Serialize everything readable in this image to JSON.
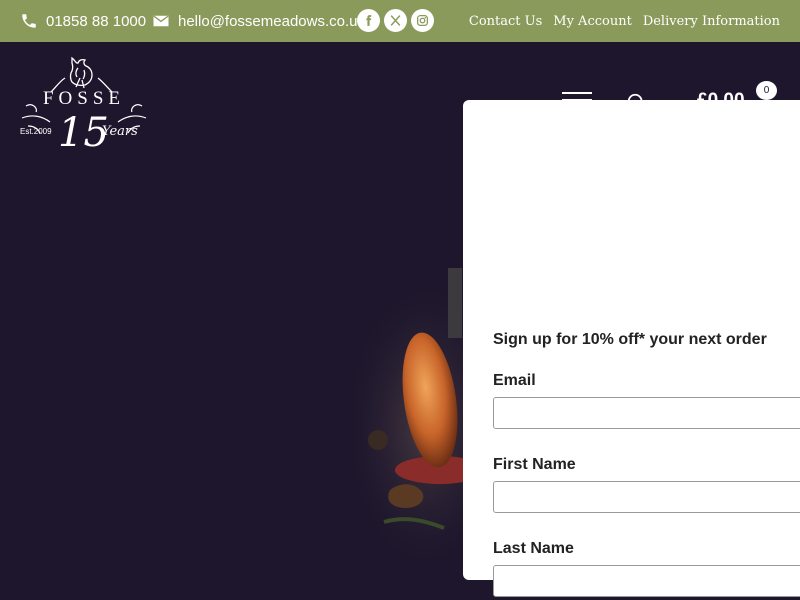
{
  "topbar": {
    "phone": "01858 88 1000",
    "email": "hello@fossemeadows.co.uk",
    "social": [
      "facebook-icon",
      "x-icon",
      "instagram-icon"
    ],
    "links": [
      "Contact Us",
      "My Account",
      "Delivery Information"
    ]
  },
  "logo": {
    "brand": "FOSSE",
    "number": "15",
    "years": "Years",
    "est": "Est.2009"
  },
  "header": {
    "cart_total": "£0.00",
    "cart_count": "0"
  },
  "signup": {
    "heading": "Sign up for 10% off* your next order",
    "email_label": "Email",
    "email_value": "",
    "first_name_label": "First Name",
    "first_name_value": "",
    "last_name_label": "Last Name",
    "last_name_value": ""
  },
  "colors": {
    "topbar": "#8a9a5b",
    "background": "#1d162c",
    "modal": "#ffffff"
  }
}
